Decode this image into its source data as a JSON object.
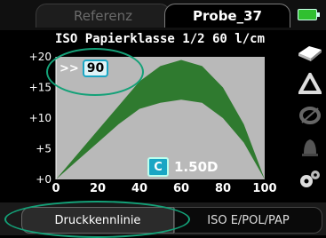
{
  "tabs": {
    "reference_label": "Referenz",
    "probe_label": "Probe_37"
  },
  "battery_icon": "battery-icon",
  "subtitle": "ISO Papierklasse 1/2   60 l/cm",
  "speed": {
    "prefix": ">>",
    "value": "90"
  },
  "c_value": {
    "icon_letter": "C",
    "value": "1.50D"
  },
  "chart_data": {
    "type": "area",
    "title": "",
    "xlabel": "",
    "ylabel": "",
    "x_ticks": [
      "0",
      "20",
      "40",
      "60",
      "80",
      "100"
    ],
    "y_ticks": [
      "+0",
      "+5",
      "+10",
      "+15",
      "+20"
    ],
    "xlim": [
      0,
      100
    ],
    "ylim": [
      0,
      20
    ],
    "series": [
      {
        "x": [
          0,
          10,
          20,
          30,
          40,
          50,
          60,
          70,
          80,
          90,
          100
        ],
        "values": [
          0,
          4,
          8,
          12,
          16,
          18.5,
          19.5,
          18.5,
          15,
          9,
          0
        ]
      },
      {
        "x": [
          0,
          10,
          20,
          30,
          40,
          50,
          60,
          70,
          80,
          90,
          100
        ],
        "values": [
          0,
          3,
          6,
          9,
          11.5,
          12.5,
          13,
          12.5,
          10,
          6,
          0
        ]
      }
    ],
    "fill_color": "#2f7a2f",
    "grid": false
  },
  "side_icons": [
    "paper-icon",
    "triangle-icon",
    "ring-icon",
    "bell-icon",
    "gear-icon"
  ],
  "bottom_tabs": {
    "left_label": "Druckkennlinie",
    "right_label": "ISO E/POL/PAP"
  }
}
